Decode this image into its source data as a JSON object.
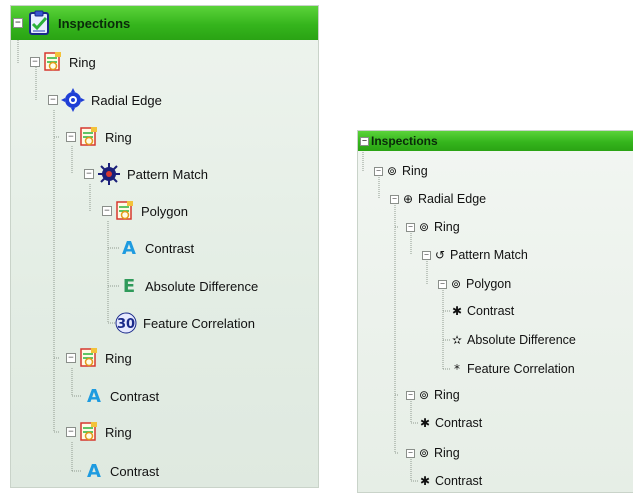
{
  "left_tree": {
    "header": {
      "label": "Inspections",
      "icon": "clipboard-check-icon"
    },
    "nodes": [
      {
        "label": "Ring",
        "icon": "ring-tool-icon"
      },
      {
        "label": "Radial Edge",
        "icon": "radial-edge-icon"
      },
      {
        "label": "Ring",
        "icon": "ring-tool-icon"
      },
      {
        "label": "Pattern Match",
        "icon": "pattern-match-icon"
      },
      {
        "label": "Polygon",
        "icon": "polygon-tool-icon"
      },
      {
        "label": "Contrast",
        "icon": "contrast-letter-icon",
        "glyph": "A"
      },
      {
        "label": "Absolute Difference",
        "icon": "absolute-difference-letter-icon",
        "glyph": "E"
      },
      {
        "label": "Feature Correlation",
        "icon": "feature-correlation-icon",
        "glyph": "ℷ"
      },
      {
        "label": "Ring",
        "icon": "ring-tool-icon"
      },
      {
        "label": "Contrast",
        "icon": "contrast-letter-icon",
        "glyph": "A"
      },
      {
        "label": "Ring",
        "icon": "ring-tool-icon"
      },
      {
        "label": "Contrast",
        "icon": "contrast-letter-icon",
        "glyph": "A"
      }
    ]
  },
  "right_tree": {
    "header": {
      "label": "Inspections"
    },
    "nodes": [
      {
        "label": "Ring",
        "glyph": "⊚"
      },
      {
        "label": "Radial Edge",
        "glyph": "⊕"
      },
      {
        "label": "Ring",
        "glyph": "⊚"
      },
      {
        "label": "Pattern Match",
        "glyph": "↺"
      },
      {
        "label": "Polygon",
        "glyph": "⊚"
      },
      {
        "label": "Contrast",
        "glyph": "✱"
      },
      {
        "label": "Absolute Difference",
        "glyph": "✫"
      },
      {
        "label": "Feature Correlation",
        "glyph": "*"
      },
      {
        "label": "Ring",
        "glyph": "⊚"
      },
      {
        "label": "Contrast",
        "glyph": "✱"
      },
      {
        "label": "Ring",
        "glyph": "⊚"
      },
      {
        "label": "Contrast",
        "glyph": "✱"
      }
    ]
  },
  "collapse_toggle_glyph": "−",
  "colors": {
    "header_green": "#3fc125",
    "tree_lines": "#8f9a8f",
    "contrast_letter": "#1e9be0",
    "absdiff_letter": "#2f9a5a",
    "radial_blue": "#1f3fd6",
    "pattern_navy": "#1a1f7a"
  }
}
